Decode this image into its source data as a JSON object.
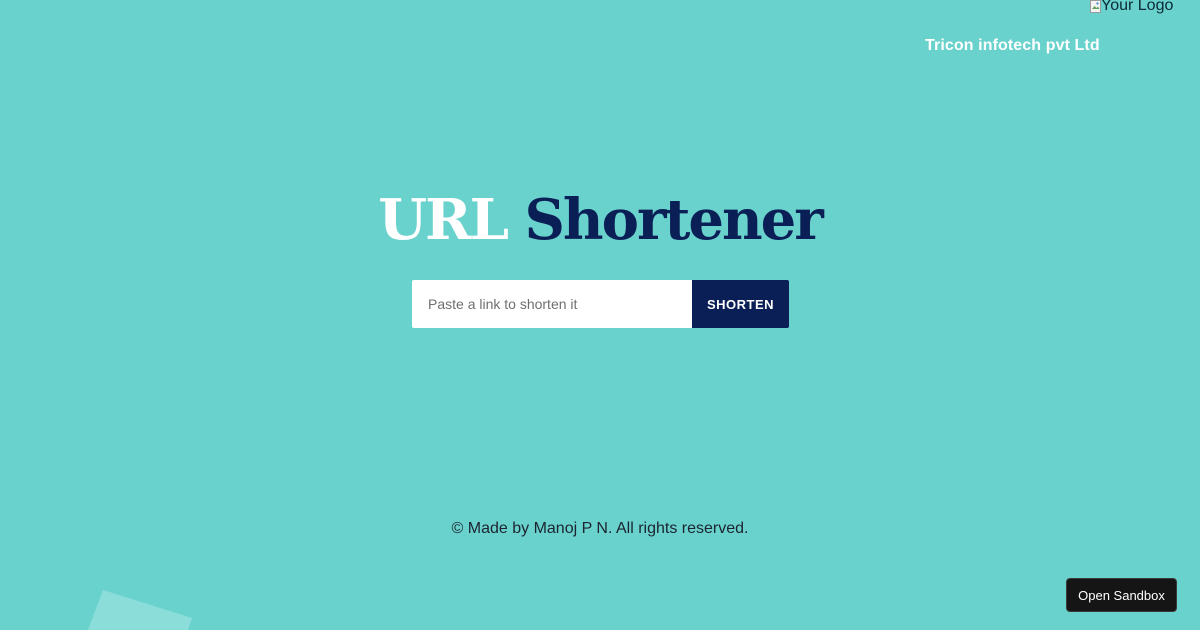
{
  "header": {
    "logo_alt": "Your Logo",
    "company_name": "Tricon infotech pvt Ltd"
  },
  "hero": {
    "title_word1": "URL",
    "title_word2": "Shortener"
  },
  "form": {
    "input_placeholder": "Paste a link to shorten it",
    "input_value": "",
    "button_label": "SHORTEN"
  },
  "footer": {
    "text": "© Made by Manoj P N. All rights reserved."
  },
  "sandbox": {
    "button_label": "Open Sandbox"
  },
  "colors": {
    "background": "#6ad2cd",
    "accent_navy": "#0a1f55",
    "title_white": "#ffffff"
  },
  "icons": {
    "logo": "broken-image-icon"
  }
}
